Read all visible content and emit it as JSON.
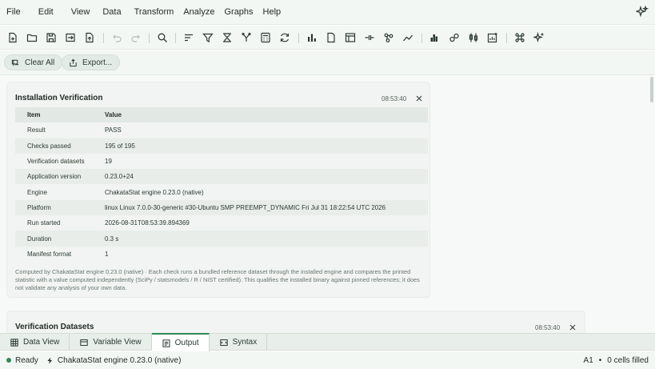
{
  "menu": [
    "File",
    "Edit",
    "View",
    "Data",
    "Transform",
    "Analyze",
    "Graphs",
    "Help"
  ],
  "toolbar": {
    "icons": [
      "new-file-icon",
      "open-folder-icon",
      "save-icon",
      "import-icon",
      "export-icon",
      "undo-icon",
      "redo-icon",
      "search-icon",
      "sort-icon",
      "filter-icon",
      "hourglass-icon",
      "merge-icon",
      "calculator-icon",
      "recode-icon",
      "bar-chart-icon",
      "document-icon",
      "table-icon",
      "split-icon",
      "network-icon",
      "trend-icon",
      "histogram-icon",
      "cluster-icon",
      "boxplot-icon",
      "add-chart-icon",
      "command-icon",
      "ai-sparkle-icon"
    ]
  },
  "actions": {
    "clear_all": "Clear All",
    "export": "Export..."
  },
  "card1": {
    "title": "Installation Verification",
    "time": "08:53:40",
    "columns": [
      "Item",
      "Value"
    ],
    "rows": [
      [
        "Result",
        "PASS"
      ],
      [
        "Checks passed",
        "195 of 195"
      ],
      [
        "Verification datasets",
        "19"
      ],
      [
        "Application version",
        "0.23.0+24"
      ],
      [
        "Engine",
        "ChakataStat engine 0.23.0 (native)"
      ],
      [
        "Platform",
        "linux Linux 7.0.0-30-generic #30-Ubuntu SMP PREEMPT_DYNAMIC Fri Jul 31 18:22:54 UTC 2026"
      ],
      [
        "Run started",
        "2026-08-31T08:53:39.894369"
      ],
      [
        "Duration",
        "0.3 s"
      ],
      [
        "Manifest format",
        "1"
      ]
    ],
    "note": "Computed by ChakataStat engine 0.23.0 (native) · Each check runs a bundled reference dataset through the installed engine and compares the printed statistic with a value computed independently (SciPy / statsmodels / R / NIST certified). This qualifies the installed binary against pinned references; it does not validate any analysis of your own data."
  },
  "card2": {
    "title": "Verification Datasets",
    "time": "08:53:40"
  },
  "tabs": [
    "Data View",
    "Variable View",
    "Output",
    "Syntax"
  ],
  "active_tab": "Output",
  "status": {
    "state": "Ready",
    "engine": "ChakataStat engine 0.23.0 (native)",
    "cell": "A1",
    "sep": "•",
    "filled": "0 cells filled"
  },
  "colors": {
    "accent": "#2f8a56",
    "background": "#f3f7f4",
    "panel": "#f1f4f2"
  }
}
